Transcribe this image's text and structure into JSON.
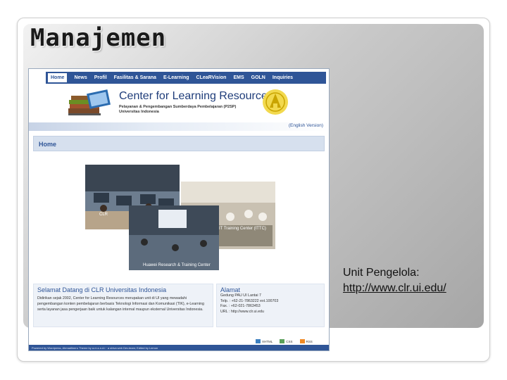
{
  "slide": {
    "title": "Manajemen",
    "caption_label": "Unit Pengelola:",
    "caption_url": "http://www.clr.ui.edu/"
  },
  "website": {
    "nav": [
      "Home",
      "News",
      "Profil",
      "Fasilitas & Sarana",
      "E-Learning",
      "CLeaRVision",
      "EMS",
      "GOLN",
      "Inquiries"
    ],
    "org_name": "Center for Learning Resources",
    "org_sub1": "Pelayanan & Pengembangan Sumberdaya Pembelajaran (P2SP)",
    "org_sub2": "Universitas Indonesia",
    "english_link": "(English Version)",
    "home_label": "Home",
    "photo_caption_1": "CLR",
    "photo_caption_2": "IT Training Center (ITTC)",
    "photo_caption_3": "Huawei Research & Training Center",
    "welcome_title": "Selamat Datang di CLR Universitas Indonesia",
    "welcome_body": "Didirikan sejak 2002, Center for Learning Resources merupakan unit di UI yang mewadahi pengembangan konten pembelajaran berbasis Teknologi Informasi dan Komunikasi (TIK), e-Learning serta layanan jasa pengerjaan baik untuk kalangan internal maupun eksternal Universitas Indonesia.",
    "address_title": "Alamat",
    "address_lines": [
      "Gedung PAU UI Lantai 7",
      "Telp. : +62-21-7863222 ext.100703",
      "Fax. : +62-021-7863453",
      "URL : http://www.clr.ui.edu"
    ],
    "badges": [
      "XHTML",
      "CSS",
      "RSS"
    ],
    "footer_text": "Powered by Wordpress, Ahmadlinero Theme by a.m.s.n.d.i · a shiva web Dev.team; Edited by Lemon"
  },
  "colors": {
    "nav_blue": "#2f5597",
    "panel_gray": "#b9b9b9",
    "link_blue": "#2f5597"
  }
}
